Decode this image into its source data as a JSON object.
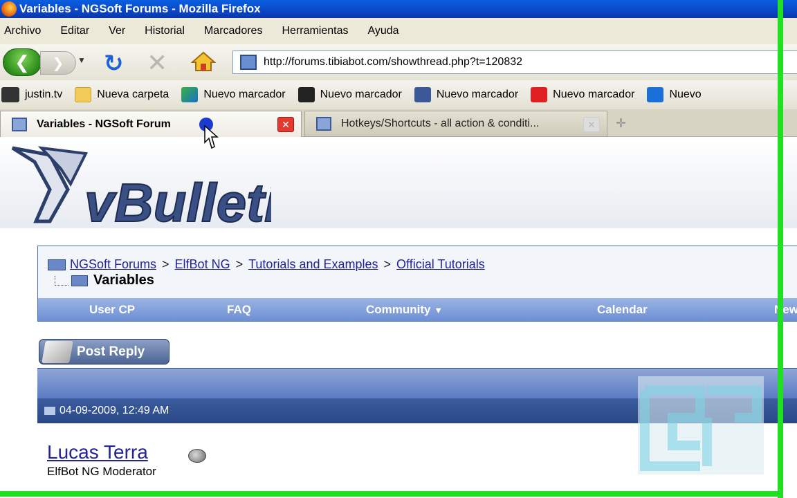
{
  "window": {
    "title": "Variables - NGSoft Forums - Mozilla Firefox"
  },
  "menu": [
    "Archivo",
    "Editar",
    "Ver",
    "Historial",
    "Marcadores",
    "Herramientas",
    "Ayuda"
  ],
  "url": "http://forums.tibiabot.com/showthread.php?t=120832",
  "bookmarks": [
    {
      "label": "justin.tv",
      "icon": "justin-tv-icon"
    },
    {
      "label": "Nueva carpeta",
      "icon": "folder-icon"
    },
    {
      "label": "Nuevo marcador",
      "icon": "bookmark-icon"
    },
    {
      "label": "Nuevo marcador",
      "icon": "dark-bookmark-icon"
    },
    {
      "label": "Nuevo marcador",
      "icon": "facebook-icon"
    },
    {
      "label": "Nuevo marcador",
      "icon": "youtube-icon"
    },
    {
      "label": "Nuevo",
      "icon": "t-icon"
    }
  ],
  "tabs": [
    {
      "label": "Variables - NGSoft Forum"
    },
    {
      "label": "Hotkeys/Shortcuts - all action & conditi..."
    }
  ],
  "page": {
    "logo_text": "vBulletin",
    "breadcrumbs": [
      "NGSoft Forums",
      "ElfBot NG",
      "Tutorials and Examples",
      "Official Tutorials"
    ],
    "breadcrumb_sep": ">",
    "current": "Variables",
    "nav": [
      "User CP",
      "FAQ",
      "Community",
      "Calendar",
      "New"
    ],
    "post_reply": "Post Reply",
    "post_date": "04-09-2009, 12:49 AM",
    "author": "Lucas Terra",
    "rank": "ElfBot NG Moderator"
  },
  "colors": {
    "frame": "#21e021",
    "link": "#22229a",
    "titlebar": "#0b46c8"
  }
}
